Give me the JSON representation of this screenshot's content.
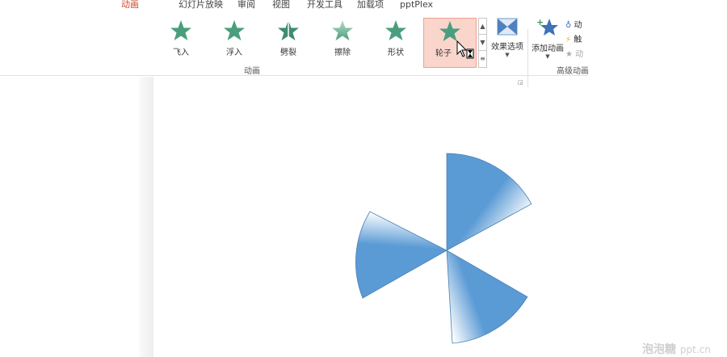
{
  "tabs": [
    {
      "label": "动画",
      "active": true
    },
    {
      "label": "幻灯片放映",
      "active": false
    },
    {
      "label": "审阅",
      "active": false
    },
    {
      "label": "视图",
      "active": false
    },
    {
      "label": "开发工具",
      "active": false
    },
    {
      "label": "加载项",
      "active": false
    },
    {
      "label": "pptPlex",
      "active": false
    }
  ],
  "ribbon": {
    "effects": [
      {
        "label": "飞入",
        "icon": "fly-in-star-icon",
        "selected": false
      },
      {
        "label": "浮入",
        "icon": "float-in-star-icon",
        "selected": false
      },
      {
        "label": "劈裂",
        "icon": "split-star-icon",
        "selected": false
      },
      {
        "label": "擦除",
        "icon": "wipe-star-icon",
        "selected": false
      },
      {
        "label": "形状",
        "icon": "shape-star-icon",
        "selected": false
      },
      {
        "label": "轮子",
        "icon": "wheel-star-icon",
        "selected": true
      }
    ],
    "gallery_scroll": [
      "▲",
      "▼",
      "≡"
    ],
    "effect_options_label": "效果选项",
    "add_animation_label": "添加动画",
    "group_animation_label": "动画",
    "group_advanced_label": "高级动画",
    "small_cmds": [
      {
        "label": "动",
        "icon": "animation-pane-icon",
        "disabled": false
      },
      {
        "label": "触",
        "icon": "trigger-icon",
        "disabled": false
      },
      {
        "label": "动",
        "icon": "animation-painter-icon",
        "disabled": true
      }
    ]
  },
  "slide": {
    "shape": "wheel-sectors",
    "fill_color": "#5b9bd5"
  },
  "watermark": {
    "brand": "泡泡糖",
    "url": "ppt.cn"
  },
  "colors": {
    "accent": "#d24726",
    "selected_bg": "#f9d5cc",
    "star_green": "#4a9e7e"
  }
}
